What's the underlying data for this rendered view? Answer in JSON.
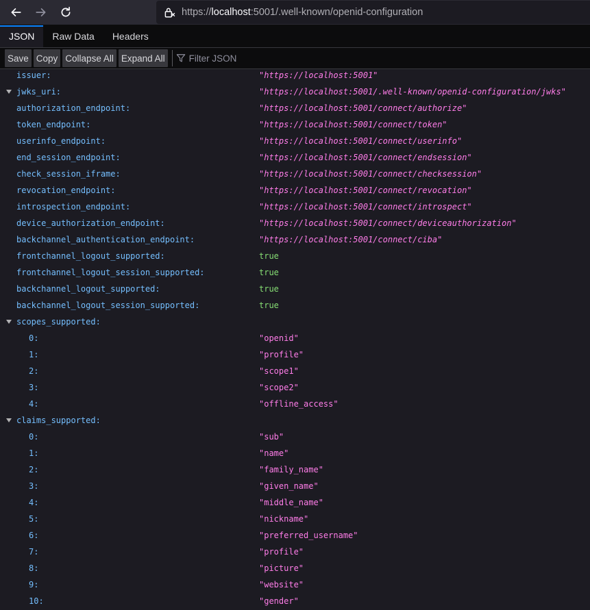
{
  "nav": {
    "back_icon": "arrow-left-icon",
    "forward_icon": "arrow-right-icon",
    "reload_icon": "reload-icon",
    "lock_icon": "lock-icon",
    "url_prefix": "https://",
    "url_host": "localhost",
    "url_rest": ":5001/.well-known/openid-configuration"
  },
  "tabs": [
    {
      "label": "JSON",
      "selected": true
    },
    {
      "label": "Raw Data",
      "selected": false
    },
    {
      "label": "Headers",
      "selected": false
    }
  ],
  "toolbar": {
    "save": "Save",
    "copy": "Copy",
    "collapse_all": "Collapse All",
    "expand_all": "Expand All",
    "filter_placeholder": "Filter JSON"
  },
  "json": {
    "issuer": {
      "key": "issuer:",
      "value": "\"https://localhost:5001\""
    },
    "jwks_uri": {
      "key": "jwks_uri:",
      "value": "\"https://localhost:5001/.well-known/openid-configuration/jwks\""
    },
    "authorization_endpoint": {
      "key": "authorization_endpoint:",
      "value": "\"https://localhost:5001/connect/authorize\""
    },
    "token_endpoint": {
      "key": "token_endpoint:",
      "value": "\"https://localhost:5001/connect/token\""
    },
    "userinfo_endpoint": {
      "key": "userinfo_endpoint:",
      "value": "\"https://localhost:5001/connect/userinfo\""
    },
    "end_session_endpoint": {
      "key": "end_session_endpoint:",
      "value": "\"https://localhost:5001/connect/endsession\""
    },
    "check_session_iframe": {
      "key": "check_session_iframe:",
      "value": "\"https://localhost:5001/connect/checksession\""
    },
    "revocation_endpoint": {
      "key": "revocation_endpoint:",
      "value": "\"https://localhost:5001/connect/revocation\""
    },
    "introspection_endpoint": {
      "key": "introspection_endpoint:",
      "value": "\"https://localhost:5001/connect/introspect\""
    },
    "device_authorization_endpoint": {
      "key": "device_authorization_endpoint:",
      "value": "\"https://localhost:5001/connect/deviceauthorization\""
    },
    "backchannel_authentication_endpoint": {
      "key": "backchannel_authentication_endpoint:",
      "value": "\"https://localhost:5001/connect/ciba\""
    },
    "frontchannel_logout_supported": {
      "key": "frontchannel_logout_supported:",
      "value": "true"
    },
    "frontchannel_logout_session_supported": {
      "key": "frontchannel_logout_session_supported:",
      "value": "true"
    },
    "backchannel_logout_supported": {
      "key": "backchannel_logout_supported:",
      "value": "true"
    },
    "backchannel_logout_session_supported": {
      "key": "backchannel_logout_session_supported:",
      "value": "true"
    },
    "scopes_supported": {
      "key": "scopes_supported:",
      "items": [
        {
          "key": "0:",
          "value": "\"openid\""
        },
        {
          "key": "1:",
          "value": "\"profile\""
        },
        {
          "key": "2:",
          "value": "\"scope1\""
        },
        {
          "key": "3:",
          "value": "\"scope2\""
        },
        {
          "key": "4:",
          "value": "\"offline_access\""
        }
      ]
    },
    "claims_supported": {
      "key": "claims_supported:",
      "items": [
        {
          "key": "0:",
          "value": "\"sub\""
        },
        {
          "key": "1:",
          "value": "\"name\""
        },
        {
          "key": "2:",
          "value": "\"family_name\""
        },
        {
          "key": "3:",
          "value": "\"given_name\""
        },
        {
          "key": "4:",
          "value": "\"middle_name\""
        },
        {
          "key": "5:",
          "value": "\"nickname\""
        },
        {
          "key": "6:",
          "value": "\"preferred_username\""
        },
        {
          "key": "7:",
          "value": "\"profile\""
        },
        {
          "key": "8:",
          "value": "\"picture\""
        },
        {
          "key": "9:",
          "value": "\"website\""
        },
        {
          "key": "10:",
          "value": "\"gender\""
        }
      ]
    }
  },
  "colors": {
    "key": "#75bfff",
    "string": "#ff7de9",
    "boolean": "#86de74",
    "background": "#1c1b22"
  }
}
